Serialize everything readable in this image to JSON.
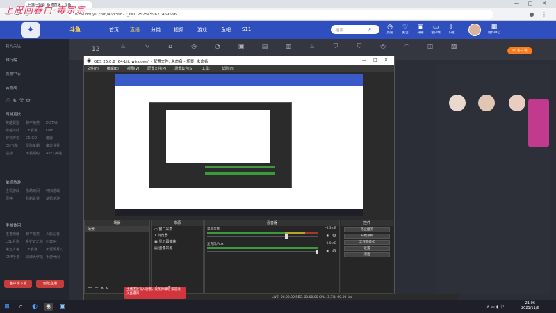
{
  "browser": {
    "tab_title": "七猫一观看_鱼塘直播 - 斗鱼",
    "url": "www.douyu.com/45336827_r=0.2525459627469566",
    "stamp_text": "上周回春白·毒宗宗"
  },
  "site": {
    "brand": "斗鱼",
    "nav": [
      "首页",
      "直播",
      "分类",
      "视频",
      "游戏",
      "鱼吧",
      "S11"
    ],
    "search_placeholder": "搜索",
    "header_icons": [
      "历史",
      "关注",
      "开播",
      "客户端",
      "下载",
      "邮件",
      "创作中心"
    ],
    "categories_num": "12",
    "pc_button": "PC客户端"
  },
  "sidebar": {
    "items": [
      "我的关注",
      "排行榜",
      "页游中心",
      "云游戏"
    ],
    "section1": "网游竞技",
    "grid1": [
      "英雄联盟",
      "和平精英",
      "DOTA2",
      "穿越火线",
      "CF手游",
      "DNF",
      "炉石传说",
      "CS:GO",
      "魔兽",
      "QQ飞车",
      "星际争霸",
      "魔兽世界",
      "逆战",
      "无畏契约",
      "APEX英雄"
    ],
    "section2": "单机热游",
    "grid2": [
      "主机游戏",
      "永劫无间",
      "怀旧游戏",
      "原神",
      "我的世界",
      "单机热游"
    ],
    "section3": "手游休闲",
    "grid3": [
      "王者荣耀",
      "和平精英",
      "火影忍者",
      "LOL手游",
      "金铲铲之战",
      "CODM",
      "第五人格",
      "CF手游",
      "天涯明月刀",
      "DNF手游",
      "球球大作战",
      "手游休闲"
    ],
    "buttons": [
      "客户端下载",
      "创建直播"
    ]
  },
  "obs": {
    "title": "OBS 25.0.8 (64-bit, windows) - 配置文件: 未命名 - 场景: 未命名",
    "menu": [
      "文件(F)",
      "编辑(E)",
      "视图(V)",
      "配置文件(P)",
      "场景集合(S)",
      "工具(T)",
      "帮助(H)"
    ],
    "docks": {
      "scenes": "场景",
      "sources": "来源",
      "mixer": "混音器",
      "controls": "控件"
    },
    "scene_items": [
      "场景"
    ],
    "sources": [
      "窗口采集",
      "浏览器",
      "显示器捕获",
      "图像来源"
    ],
    "mixer": [
      {
        "name": "桌面音频",
        "level": "-0.3 dB"
      },
      {
        "name": "麦克风/Aux",
        "level": "0.0 dB"
      }
    ],
    "controls": [
      "停止推流",
      "开始录制",
      "工作室模式",
      "设置",
      "退出"
    ],
    "status": "LIVE: 00:00:00   REC: 00:00:00   CPU: 3.5%, 60.00 fps"
  },
  "danmu": "主播还没有入驻哦，发条弹幕吧 欢迎进入直播间",
  "taskbar": {
    "time": "21:06",
    "date": "2021/11/6"
  },
  "colors": {
    "site_blue": "#2f4fbf",
    "accent_orange": "#ff7a1a"
  }
}
